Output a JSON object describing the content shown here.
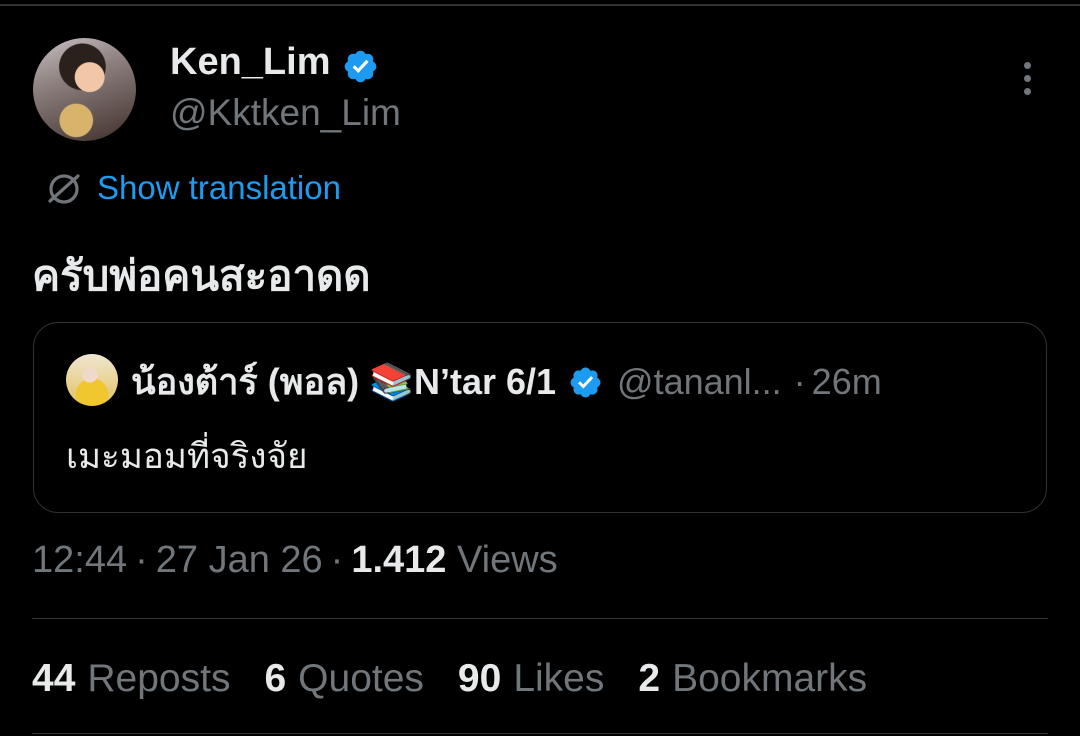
{
  "author": {
    "display_name": "Ken_Lim",
    "handle": "@Kktken_Lim",
    "verified": true
  },
  "translate_link": "Show translation",
  "tweet_text": "ครับพ่อคนสะอาดด",
  "quote": {
    "display_name": "น้องต้าร์ (พอล) 📚N’tar 6/1",
    "handle": "@tananl...",
    "separator": "·",
    "time": "26m",
    "text": "เมะมอมที่จริงจัย",
    "verified": true
  },
  "meta": {
    "time": "12:44",
    "date": "27 Jan 26",
    "views_count": "1.412",
    "views_label": "Views"
  },
  "stats": [
    {
      "count": "44",
      "label": "Reposts"
    },
    {
      "count": "6",
      "label": "Quotes"
    },
    {
      "count": "90",
      "label": "Likes"
    },
    {
      "count": "2",
      "label": "Bookmarks"
    }
  ],
  "colors": {
    "background": "#000000",
    "text": "#e7e9ea",
    "muted": "#71767b",
    "accent": "#1d9bf0",
    "border": "#2f3336"
  },
  "icons": [
    "verified-badge-icon",
    "more-options-icon",
    "translate-icon"
  ]
}
